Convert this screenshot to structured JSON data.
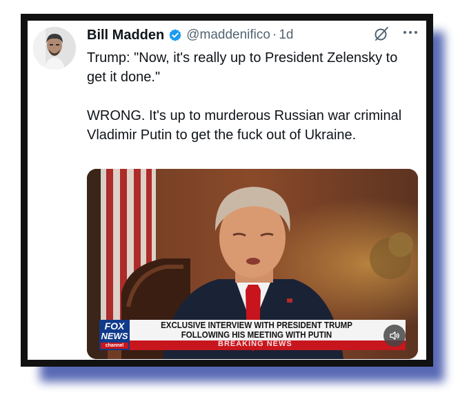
{
  "post": {
    "author_name": "Bill Madden",
    "handle": "@maddenifico",
    "separator": "·",
    "time": "1d",
    "text": [
      "Trump: \"Now, it's really up to President Zelensky to get it done.\"",
      "WRONG. It's up to murderous Russian war criminal Vladimir Putin to get the fuck out of Ukraine."
    ]
  },
  "media": {
    "network_logo": {
      "line1": "FOX",
      "line2": "NEWS",
      "line3": "channel"
    },
    "chyron": {
      "line1": "EXCLUSIVE INTERVIEW WITH PRESIDENT TRUMP",
      "line2": "FOLLOWING HIS MEETING WITH PUTIN",
      "ticker": "BREAKING NEWS"
    }
  },
  "icons": {
    "verified": "verified-badge-icon",
    "grok": "grok-icon",
    "more": "more-icon",
    "sound": "speaker-icon"
  },
  "colors": {
    "frame": "#111111",
    "shadow": "#3b4fa8",
    "verified": "#1d9bf0",
    "text": "#0f1419",
    "muted": "#536471",
    "chyron_red": "#c7161d",
    "fox_blue": "#103a8a"
  }
}
